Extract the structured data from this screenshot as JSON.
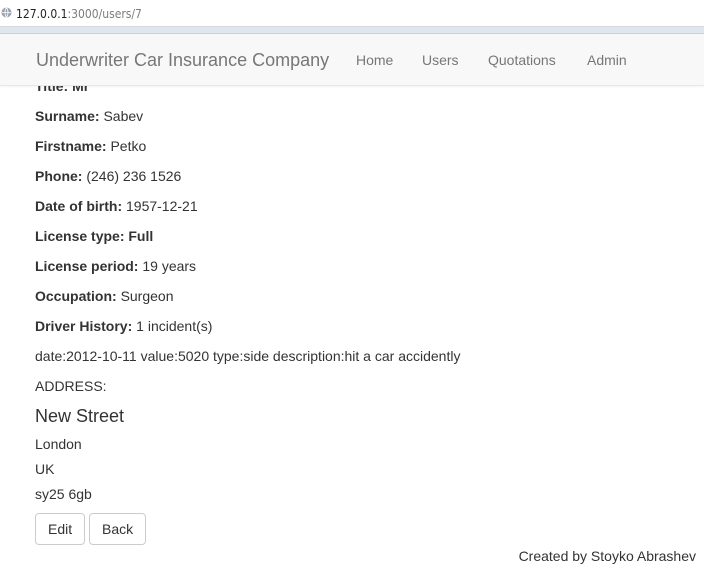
{
  "browser": {
    "url_host": "127.0.0.1",
    "url_path": ":3000/users/7"
  },
  "navbar": {
    "brand": "Underwriter Car Insurance Company",
    "items": [
      {
        "label": "Home"
      },
      {
        "label": "Users"
      },
      {
        "label": "Quotations"
      },
      {
        "label": "Admin"
      }
    ]
  },
  "user": {
    "title_label": "Title:",
    "title_value": "Mr",
    "surname_label": "Surname:",
    "surname_value": "Sabev",
    "firstname_label": "Firstname:",
    "firstname_value": "Petko",
    "phone_label": "Phone:",
    "phone_value": "(246) 236 1526",
    "dob_label": "Date of birth:",
    "dob_value": "1957-12-21",
    "license_type_label": "License type:",
    "license_type_value": "Full",
    "license_period_label": "License period:",
    "license_period_value": "19 years",
    "occupation_label": "Occupation:",
    "occupation_value": "Surgeon",
    "driver_history_label": "Driver History:",
    "driver_history_value": "1 incident(s)",
    "incident": "date:2012-10-11 value:5020 type:side description:hit a car accidently"
  },
  "address": {
    "heading": "ADDRESS:",
    "street": "New Street",
    "city": "London",
    "country": "UK",
    "postcode": "sy25 6gb"
  },
  "actions": {
    "edit_label": "Edit",
    "back_label": "Back"
  },
  "footer": {
    "credit": "Created by Stoyko Abrashev"
  }
}
